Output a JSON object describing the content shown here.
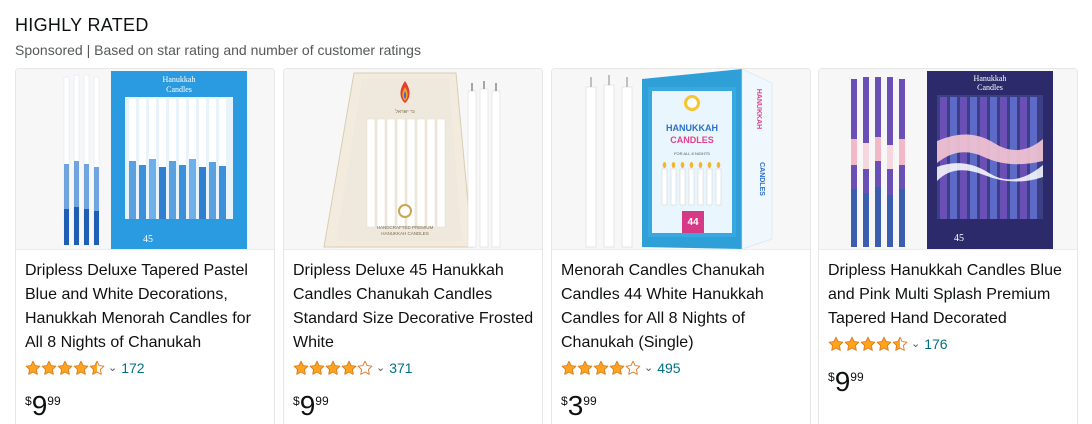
{
  "section": {
    "title": "HIGHLY RATED",
    "subtitle": "Sponsored | Based on star rating and number of customer ratings"
  },
  "colors": {
    "star": "#ffa41c",
    "link": "#007185",
    "muted": "#565959"
  },
  "products": [
    {
      "name": "Dripless Deluxe Tapered Pastel Blue and White Decorations, Hanukkah Menorah Candles for All 8 Nights of Chanukah",
      "rating": 4.5,
      "rating_count": "172",
      "price_symbol": "$",
      "price_whole": "9",
      "price_fraction": "99",
      "image_box_text": "Hanukkah Candles",
      "image_box_number": "45"
    },
    {
      "name": "Dripless Deluxe 45 Hanukkah Candles Chanukah Candles Standard Size Decorative Frosted White",
      "rating": 4.0,
      "rating_count": "371",
      "price_symbol": "$",
      "price_whole": "9",
      "price_fraction": "99",
      "image_box_text": "HANDCRAFTED PREMIUM HANUKKAH CANDLES"
    },
    {
      "name": "Menorah Candles Chanukah Candles 44 White Hanukkah Candles for All 8 Nights of Chanukah (Single)",
      "rating": 4.0,
      "rating_count": "495",
      "price_symbol": "$",
      "price_whole": "3",
      "price_fraction": "99",
      "image_box_text": "HANUKKAH CANDLES",
      "image_box_number": "44"
    },
    {
      "name": "Dripless Hanukkah Candles Blue and Pink Multi Splash Premium Tapered Hand Decorated",
      "rating": 4.5,
      "rating_count": "176",
      "price_symbol": "$",
      "price_whole": "9",
      "price_fraction": "99",
      "image_box_text": "Hanukkah Candles",
      "image_box_number": "45"
    }
  ]
}
